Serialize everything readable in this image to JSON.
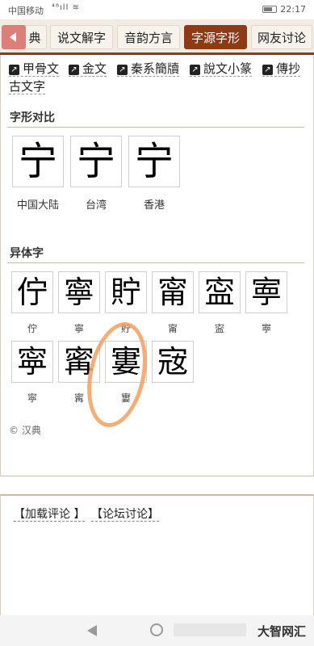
{
  "status_bar": {
    "carrier": "中国移动",
    "signal": "⁴⁶ıll ≋",
    "time": "22:17"
  },
  "tabs": [
    {
      "label": "典"
    },
    {
      "label": "说文解字"
    },
    {
      "label": "音韵方言"
    },
    {
      "label": "字源字形",
      "active": true
    },
    {
      "label": "网友讨论"
    }
  ],
  "links": [
    {
      "label": "甲骨文"
    },
    {
      "label": "金文"
    },
    {
      "label": "秦系簡牘"
    },
    {
      "label": "說文小篆"
    },
    {
      "label": "傳抄"
    }
  ],
  "links_wrap": "古文字",
  "compare_section": {
    "title": "字形对比",
    "items": [
      {
        "glyph": "宁",
        "label": "中国大陆"
      },
      {
        "glyph": "宁",
        "label": "台湾"
      },
      {
        "glyph": "宁",
        "label": "香港"
      }
    ]
  },
  "variants_section": {
    "title": "异体字",
    "items": [
      {
        "glyph": "佇",
        "label": "佇"
      },
      {
        "glyph": "寧",
        "label": "寧"
      },
      {
        "glyph": "貯",
        "label": "貯"
      },
      {
        "glyph": "甯",
        "label": "甯"
      },
      {
        "glyph": "寍",
        "label": "寍"
      },
      {
        "glyph": "寕",
        "label": "寕"
      },
      {
        "glyph": "寜",
        "label": "寜"
      },
      {
        "glyph": "寗",
        "label": "寗"
      },
      {
        "glyph": "寠",
        "label": "寠"
      },
      {
        "glyph": "宼",
        "label": ""
      }
    ]
  },
  "copyright": "© 汉典",
  "comments": {
    "load_comments": "【加载评论 】",
    "forum": "【论坛讨论】"
  },
  "nav": {
    "watermark": "大智网汇"
  },
  "colors": {
    "accent": "#8e3a17",
    "tab_bg": "#f1ebe3",
    "annotation": "#f0a05e"
  }
}
